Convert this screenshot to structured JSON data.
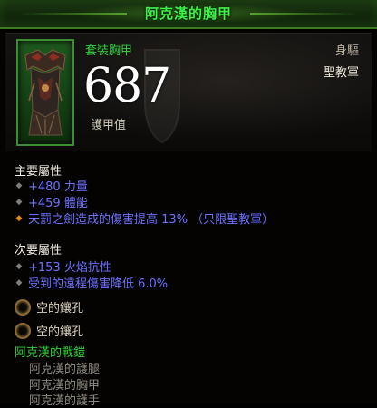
{
  "item": {
    "title": "阿克漢的胸甲",
    "type": "套裝胸甲",
    "slot": "身驅",
    "class": "聖教軍",
    "armor_value": "687",
    "armor_label": "護甲值"
  },
  "primary": {
    "title": "主要屬性",
    "stats": [
      "+480 力量",
      "+459 體能",
      "天罰之劍造成的傷害提高 13% （只限聖教軍）"
    ]
  },
  "secondary": {
    "title": "次要屬性",
    "stats": [
      "+153 火焰抗性",
      "受到的遠程傷害降低 6.0%"
    ]
  },
  "sockets": [
    "空的鑲孔",
    "空的鑲孔"
  ],
  "set": {
    "name": "阿克漢的戰鎧",
    "pieces": [
      "阿克漢的護腿",
      "阿克漢的胸甲",
      "阿克漢的護手"
    ]
  },
  "colors": {
    "title_green": "#3ff04a",
    "set_green": "#34d03c",
    "magic_blue": "#6d72ff",
    "legendary_orange": "#e6881c"
  }
}
